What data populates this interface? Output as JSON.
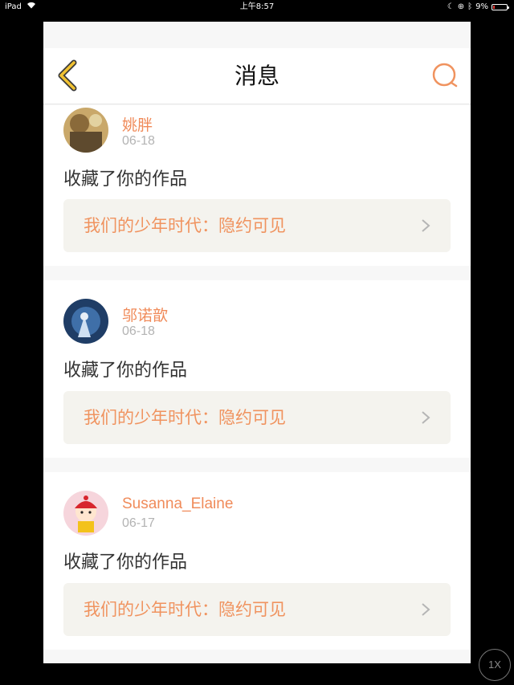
{
  "status": {
    "device": "iPad",
    "time": "上午8:57",
    "battery": "9%"
  },
  "nav": {
    "title": "消息"
  },
  "messages": [
    {
      "user": "姚胖",
      "date": "06-18",
      "action": "收藏了你的作品",
      "work": "我们的少年时代：隐约可见",
      "avatar_color": "#b8955a"
    },
    {
      "user": "邬诺歆",
      "date": "06-18",
      "action": "收藏了你的作品",
      "work": "我们的少年时代：隐约可见",
      "avatar_color": "#2a4e7a"
    },
    {
      "user": "Susanna_Elaine",
      "date": "06-17",
      "action": "收藏了你的作品",
      "work": "我们的少年时代：隐约可见",
      "avatar_color": "#f6d5dc"
    }
  ],
  "zoom": {
    "label": "1X"
  },
  "colors": {
    "accent": "#f08b5a",
    "back_arrow": "#f1c232",
    "card_bg": "#f4f3ee"
  }
}
